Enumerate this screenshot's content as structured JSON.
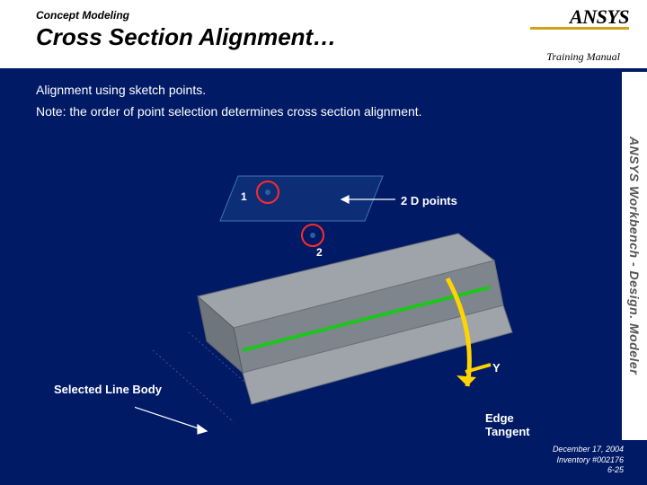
{
  "header": {
    "pretitle": "Concept Modeling",
    "title": "Cross Section Alignment…",
    "training": "Training Manual",
    "logo_text": "ANSYS"
  },
  "sidebar": {
    "vertical": "ANSYS Workbench - Design. Modeler"
  },
  "body": {
    "line1": "Alignment using sketch points.",
    "line2": "Note: the order of point selection determines cross section alignment."
  },
  "labels": {
    "pt1": "1",
    "pt2": "2",
    "points2d": "2 D points",
    "y": "Y",
    "selected": "Selected Line Body",
    "edge": "Edge Tangent"
  },
  "footer": {
    "date": "December 17, 2004",
    "inv": "Inventory #002176",
    "page": "6-25"
  }
}
